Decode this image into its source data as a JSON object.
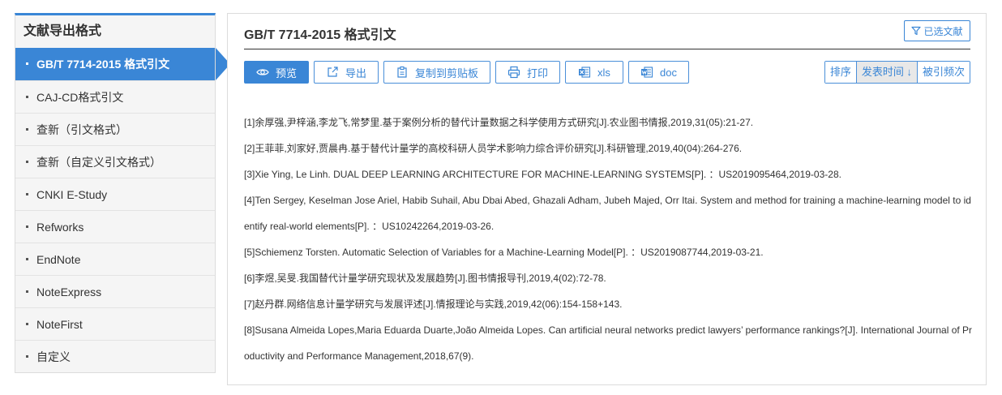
{
  "sidebar": {
    "title": "文献导出格式",
    "items": [
      {
        "label": "GB/T 7714-2015 格式引文",
        "active": true
      },
      {
        "label": "CAJ-CD格式引文"
      },
      {
        "label": "查新（引文格式）"
      },
      {
        "label": "查新（自定义引文格式）"
      },
      {
        "label": "CNKI E-Study"
      },
      {
        "label": "Refworks"
      },
      {
        "label": "EndNote"
      },
      {
        "label": "NoteExpress"
      },
      {
        "label": "NoteFirst"
      },
      {
        "label": "自定义"
      }
    ]
  },
  "main": {
    "title": "GB/T 7714-2015 格式引文",
    "selected_label": "已选文献",
    "toolbar": {
      "preview": "预览",
      "export": "导出",
      "copy": "复制到剪贴板",
      "print": "打印",
      "xls": "xls",
      "doc": "doc"
    },
    "sort": {
      "label": "排序",
      "pubtime": "发表时间",
      "cited": "被引频次"
    },
    "references": [
      "[1]余厚强,尹梓涵,李龙飞,常梦里.基于案例分析的替代计量数据之科学使用方式研究[J].农业图书情报,2019,31(05):21-27.",
      "[2]王菲菲,刘家好,贾晨冉.基于替代计量学的高校科研人员学术影响力综合评价研究[J].科研管理,2019,40(04):264-276.",
      "[3]Xie Ying, Le Linh. DUAL DEEP LEARNING ARCHITECTURE FOR MACHINE-LEARNING SYSTEMS[P]. ：US2019095464,2019-03-28.",
      "[4]Ten Sergey, Keselman Jose Ariel, Habib Suhail, Abu Dbai Abed, Ghazali Adham, Jubeh Majed, Orr Itai. System and method for training a machine-learning model to identify real-world elements[P]. ：US10242264,2019-03-26.",
      "[5]Schiemenz Torsten. Automatic Selection of Variables for a Machine-Learning Model[P]. ：US2019087744,2019-03-21.",
      "[6]李煜,吴旻.我国替代计量学研究现状及发展趋势[J].图书情报导刊,2019,4(02):72-78.",
      "[7]赵丹群.网络信息计量学研究与发展评述[J].情报理论与实践,2019,42(06):154-158+143.",
      "[8]Susana Almeida Lopes,Maria Eduarda Duarte,João Almeida Lopes. Can artificial neural networks predict lawyers’ performance rankings?[J]. International Journal of Productivity and Performance Management,2018,67(9)."
    ]
  },
  "colors": {
    "accent": "#3a86d6",
    "sidebar_bg": "#f5f5f5"
  }
}
